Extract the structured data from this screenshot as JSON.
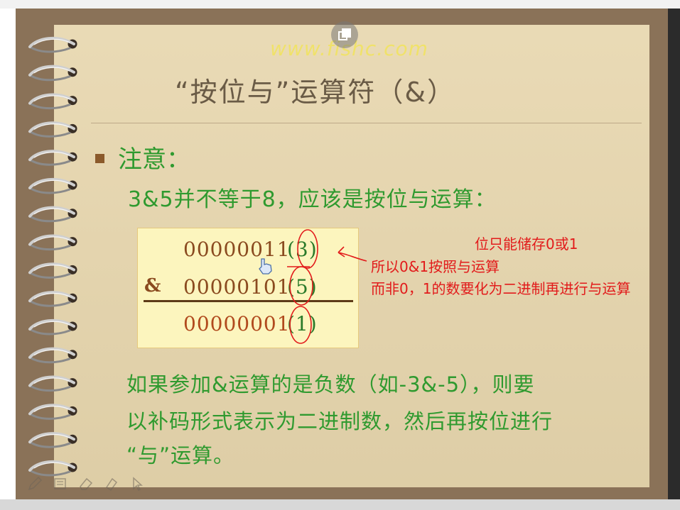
{
  "slide": {
    "watermark": "www.fishc.com",
    "title": "“按位与”运算符（&）",
    "note_label": "注意：",
    "line1": "3&5并不等于8，应该是按位与运算：",
    "calculation": {
      "rows": [
        {
          "operator": "",
          "binary": "00000011",
          "decimal": "(3)"
        },
        {
          "operator": "&",
          "binary": "00000101",
          "decimal": "(5)"
        },
        {
          "operator": "",
          "binary": "00000001",
          "decimal": "(1)"
        }
      ]
    },
    "annotations": {
      "line_a": "位只能储存0或1",
      "line_b": "所以0&1按照与运算",
      "line_c": "而非0，1的数要化为二进制再进行与运算"
    },
    "paragraph": {
      "line1": "如果参加&运算的是负数（如-3&-5），则要",
      "line2": "以补码形式表示为二进制数，然后再按位进行",
      "line3": "“与”运算。"
    }
  },
  "colors": {
    "paper": "#e7d6ad",
    "frame": "#8a7258",
    "green_text": "#2f9a2f",
    "title_text": "#6a5b46",
    "annotation_red": "#e21b1b",
    "watermark_yellow": "#f0e26a"
  },
  "icons": {
    "popout": "popout-icon",
    "pen": "pen-icon",
    "marker": "marker-icon",
    "eraser": "eraser-icon",
    "pointer": "pointer-icon",
    "hand_cursor": "hand-cursor-icon"
  }
}
